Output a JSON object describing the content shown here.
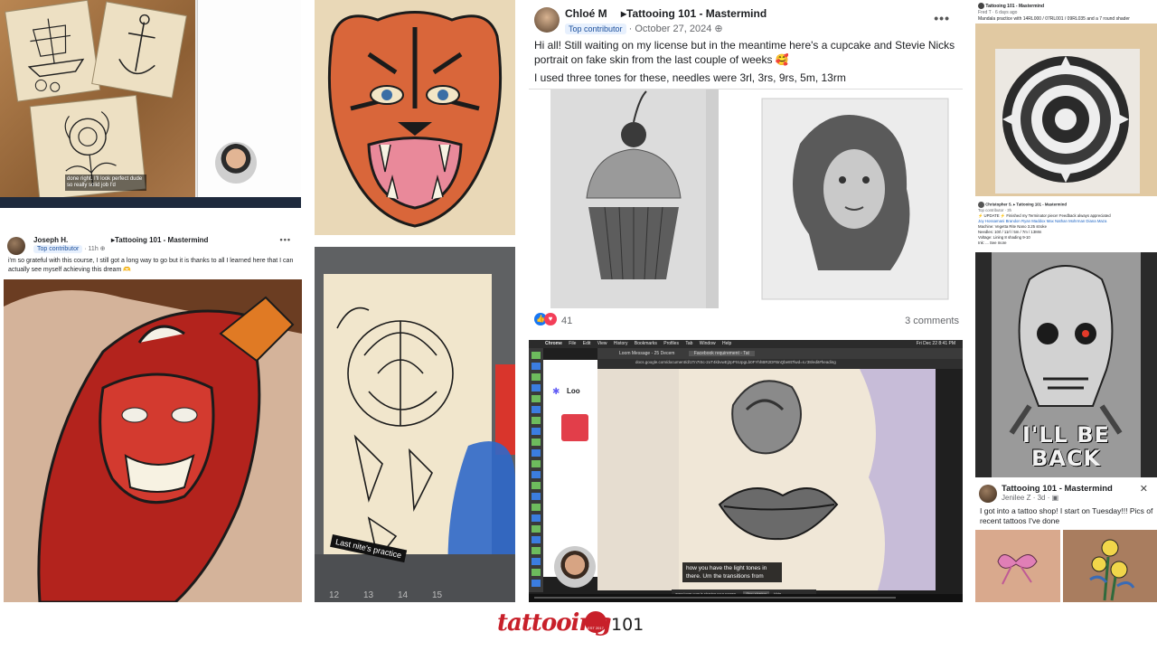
{
  "flash_tile": {
    "caption": "done right. I'll look perfect dude so really solid job I'd"
  },
  "chloe_post": {
    "author": "Chloé M",
    "group": "Tattooing 101 - Mastermind",
    "badge": "Top contributor",
    "date": "October 27, 2024",
    "more": "•••",
    "text_1": "Hi all! Still waiting on my license but in the meantime here's a cupcake and Stevie Nicks portrait on fake skin from the last couple of weeks 🥰",
    "text_2": "I used three tones for these, needles were 3rl, 3rs, 9rs, 5m, 13rm",
    "reaction_count": "41",
    "comments": "3 comments"
  },
  "mandala_post": {
    "group": "Tattooing 101 - Mastermind",
    "author": "Fred T",
    "time": "6 days ago",
    "text": "Mandala practice with 14RL000 / 07RL001 / 09RL035 and a 7 round shader"
  },
  "joseph_post": {
    "author": "Joseph H.",
    "group": "Tattooing 101 - Mastermind",
    "badge": "Top contributor",
    "time": "11h",
    "more": "•••",
    "text": "i'm so grateful with this course, I still got a long way to go but it is thanks to all I learned here that  I can actually see myself achieving this dream 🫶"
  },
  "peony_tile": {
    "caption": "Last nite's practice",
    "ruler": [
      "12",
      "13",
      "14",
      "15"
    ]
  },
  "screen_tile": {
    "menu": [
      "Chrome",
      "File",
      "Edit",
      "View",
      "History",
      "Bookmarks",
      "Profiles",
      "Tab",
      "Window",
      "Help"
    ],
    "clock": "Fri Dec 22  8:41 PM",
    "tab_1": "Loom Message - 25 Decem",
    "tab_2": "Facebook requirement - Tat",
    "url": "docs.google.com/document/d/1Tn7ISc-2oT4kbvwEj2pPSUpgLb0FYhhBR2DFBnQbe8t7lwd=s.r38/edit#heading",
    "side_label": "Loo",
    "caption": "how you have the light tones in there. Um the transitions from",
    "share_notice": "www.loom.com is sharing your screen.",
    "stop_sharing": "Stop sharing",
    "hide": "Hide"
  },
  "term_post": {
    "author": "Christopher S.",
    "group": "Tattooing 101 - Mastermind",
    "badge": "Top contributor",
    "time": "3h",
    "line_1": "⚡ UPDATE ⚡ Finished my Terminator piece! Feedback always appreciated",
    "names": "Joy Hossamani  Brandon Ryan  Maddox Max  Nathan Mohrman  Diana Maza",
    "line_2": "Machine: Vegetta Rite Nano 3.25 stroke",
    "line_3": "Needles: 10rl / 11rl / 5m / 7m / 13Mm",
    "line_4": "Voltage: Lining 8 shading 9-10",
    "line_5": "Ink: ... See more",
    "art_text_1": "I'LL BE",
    "art_text_2": "BACK"
  },
  "shop_post": {
    "group": "Tattooing 101 - Mastermind",
    "author": "Jenilee Z",
    "time": "3d",
    "close": "✕",
    "text": "I got into a tattoo shop! I start on Tuesday!!! Pics of recent tattoos I've done"
  },
  "logo": {
    "word": "tattooing",
    "number": "101",
    "stamp": "EST 2017"
  },
  "colors": {
    "brand_red": "#c8202a",
    "fb_blue": "#1877f2",
    "badge_bg": "#e7f0fd"
  }
}
